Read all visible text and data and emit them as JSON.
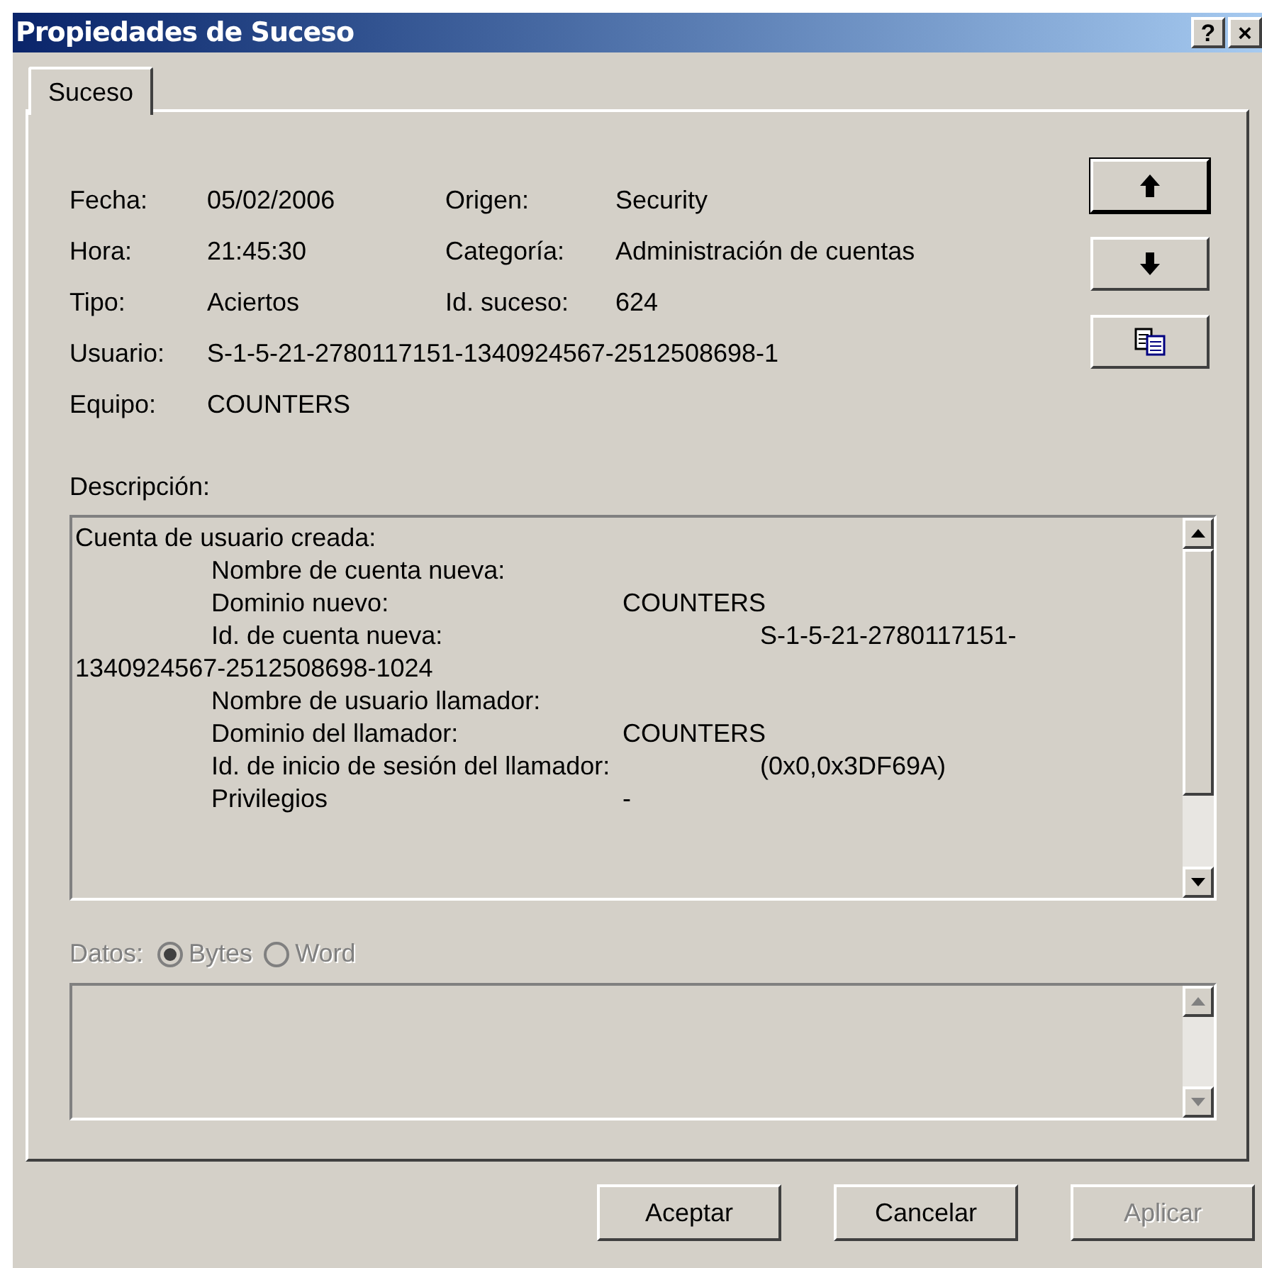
{
  "window": {
    "title": "Propiedades de Suceso",
    "controls": [
      "?",
      "×"
    ]
  },
  "tabs": [
    {
      "label": "Suceso",
      "selected": true
    }
  ],
  "fields_left": [
    {
      "label": "Fecha:",
      "value": "05/02/2006"
    },
    {
      "label": "Hora:",
      "value": "21:45:30"
    },
    {
      "label": "Tipo:",
      "value": "Aciertos"
    },
    {
      "label": "Usuario:",
      "value": "S-1-5-21-2780117151-1340924567-2512508698-1"
    },
    {
      "label": "Equipo:",
      "value": "COUNTERS"
    }
  ],
  "fields_right": [
    {
      "label": "Origen:",
      "value": "Security"
    },
    {
      "label": "Categoría:",
      "value": "Administración de cuentas"
    },
    {
      "label": "Id. suceso:",
      "value": "624"
    }
  ],
  "side_buttons": [
    {
      "kind": "up",
      "focused": true
    },
    {
      "kind": "down",
      "focused": false
    },
    {
      "kind": "copy",
      "focused": false
    }
  ],
  "description": {
    "label": "Descripción:",
    "lines": [
      {
        "kind": "heading",
        "cells": [
          "Cuenta de usuario creada:"
        ]
      },
      {
        "kind": "field",
        "cells": [
          "Nombre de cuenta nueva:"
        ]
      },
      {
        "kind": "field",
        "cells": [
          "Dominio nuevo:",
          "COUNTERS"
        ]
      },
      {
        "kind": "field_far",
        "cells": [
          "Id. de cuenta nueva:",
          "S-1-5-21-2780117151-"
        ]
      },
      {
        "kind": "heading",
        "cells": [
          "1340924567-2512508698-1024"
        ]
      },
      {
        "kind": "field",
        "cells": [
          "Nombre de usuario llamador:"
        ]
      },
      {
        "kind": "field",
        "cells": [
          "Dominio del llamador:",
          "COUNTERS"
        ]
      },
      {
        "kind": "field_far",
        "cells": [
          "Id. de inicio de sesión del llamador:",
          "(0x0,0x3DF69A)"
        ]
      },
      {
        "kind": "field",
        "cells": [
          "Privilegios",
          "-"
        ]
      }
    ]
  },
  "data": {
    "label": "Datos:",
    "disabled": true,
    "options": [
      {
        "label": "Bytes",
        "selected": true
      },
      {
        "label": "Word",
        "selected": false
      }
    ]
  },
  "buttons": [
    {
      "label": "Aceptar",
      "disabled": false
    },
    {
      "label": "Cancelar",
      "disabled": false
    },
    {
      "label": "Aplicar",
      "disabled": true
    }
  ]
}
